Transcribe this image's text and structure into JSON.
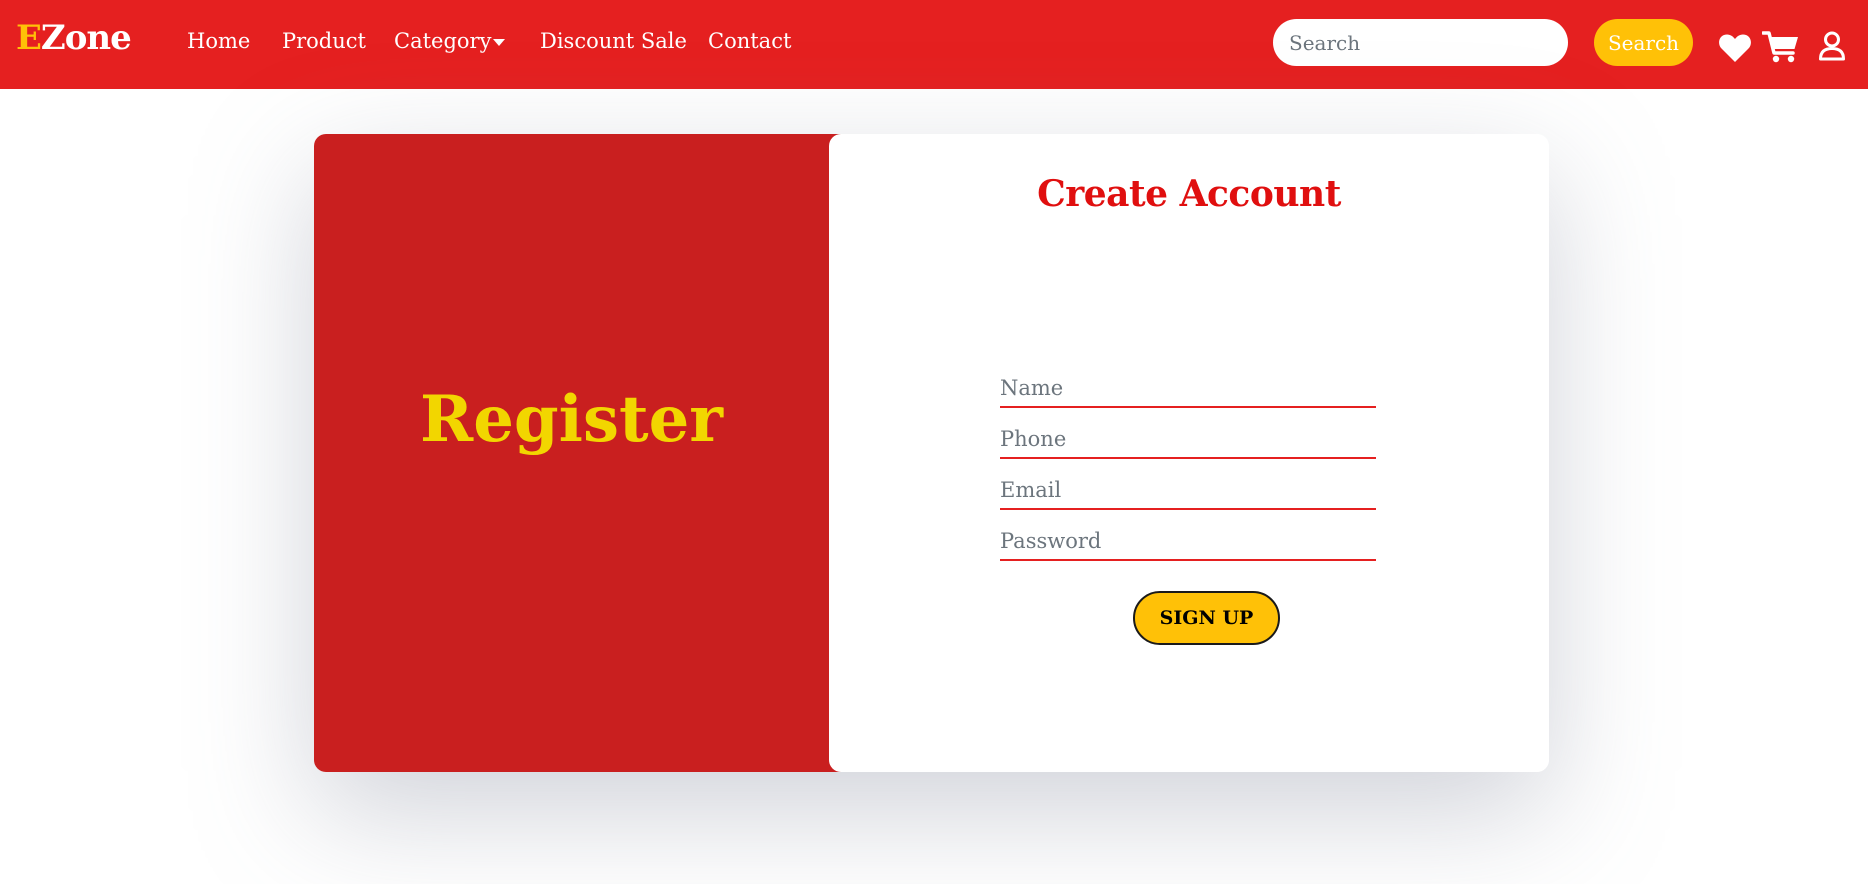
{
  "brand": {
    "first_letter": "E",
    "rest": "Zone"
  },
  "nav": {
    "home": "Home",
    "product": "Product",
    "category": "Category",
    "discount_sale": "Discount Sale",
    "contact": "Contact"
  },
  "search": {
    "placeholder": "Search",
    "value": "",
    "button_label": "Search"
  },
  "icons": {
    "wishlist": "heart-icon",
    "cart": "cart-icon",
    "account": "user-icon"
  },
  "register_panel": {
    "title": "Register"
  },
  "form": {
    "title": "Create Account",
    "name_placeholder": "Name",
    "phone_placeholder": "Phone",
    "email_placeholder": "Email",
    "password_placeholder": "Password",
    "signup_label": "SIGN UP"
  },
  "colors": {
    "navbar": "#e52020",
    "accent_yellow": "#ffc107",
    "panel_red": "#c91f1f",
    "register_title": "#f2d600",
    "form_title": "#e00f0f"
  }
}
